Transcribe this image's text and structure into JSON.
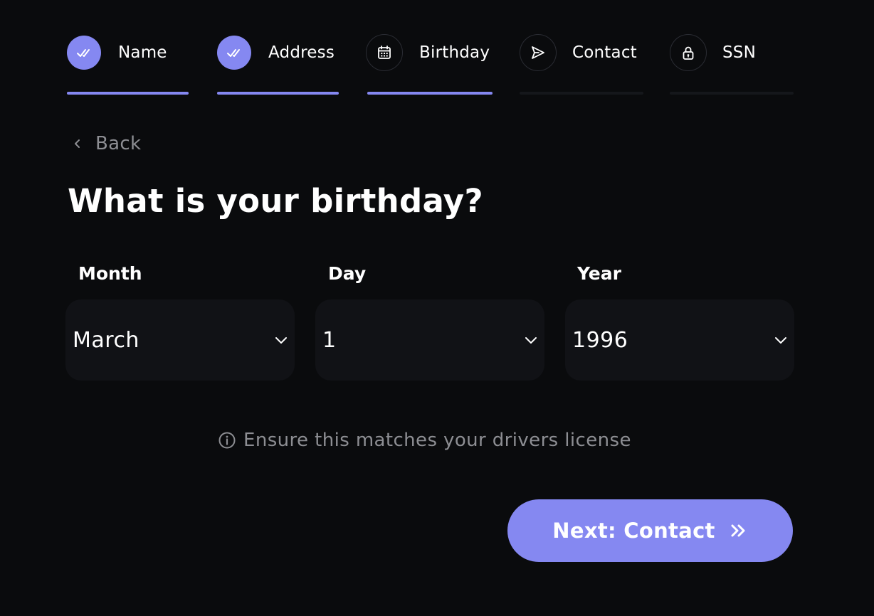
{
  "stepper": {
    "steps": [
      {
        "label": "Name",
        "status": "completed",
        "icon": "double-check-icon"
      },
      {
        "label": "Address",
        "status": "completed",
        "icon": "double-check-icon"
      },
      {
        "label": "Birthday",
        "status": "current",
        "icon": "calendar-icon"
      },
      {
        "label": "Contact",
        "status": "upcoming",
        "icon": "send-icon"
      },
      {
        "label": "SSN",
        "status": "upcoming",
        "icon": "lock-icon"
      }
    ]
  },
  "back": {
    "label": "Back",
    "icon": "chevron-left-icon"
  },
  "title": "What is your birthday?",
  "fields": {
    "month": {
      "label": "Month",
      "value": "March"
    },
    "day": {
      "label": "Day",
      "value": "1"
    },
    "year": {
      "label": "Year",
      "value": "1996"
    }
  },
  "hint": {
    "text": "Ensure this matches your drivers license",
    "icon": "info-icon"
  },
  "next_button": {
    "label": "Next: Contact",
    "icon": "double-chevron-right-icon"
  },
  "colors": {
    "accent": "#8588f1",
    "background": "#0a0b0d",
    "field_bg": "#111216",
    "muted_text": "#8d8e93"
  }
}
